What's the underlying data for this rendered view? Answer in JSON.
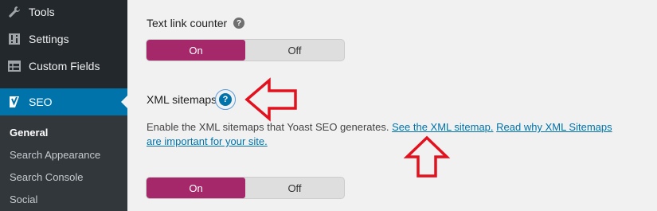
{
  "sidebar": {
    "items": [
      {
        "label": "Tools",
        "icon": "wrench-icon"
      },
      {
        "label": "Settings",
        "icon": "sliders-icon"
      },
      {
        "label": "Custom Fields",
        "icon": "table-icon"
      },
      {
        "label": "SEO",
        "icon": "yoast-icon",
        "active": true
      }
    ],
    "submenu": [
      {
        "label": "General",
        "current": true
      },
      {
        "label": "Search Appearance"
      },
      {
        "label": "Search Console"
      },
      {
        "label": "Social"
      }
    ]
  },
  "text_link_counter": {
    "label": "Text link counter",
    "help": "?",
    "toggle": {
      "on_label": "On",
      "off_label": "Off",
      "selected": "On"
    }
  },
  "xml_sitemaps": {
    "label": "XML sitemaps",
    "help": "?",
    "description": "Enable the XML sitemaps that Yoast SEO generates.",
    "link_see": "See the XML sitemap.",
    "link_read_line1": "Read why XML Sitemaps",
    "link_read_line2": "are important for your site.",
    "toggle": {
      "on_label": "On",
      "off_label": "Off",
      "selected": "On"
    }
  },
  "colors": {
    "sidebar_bg": "#23282d",
    "submenu_bg": "#32373c",
    "active_menu": "#0073aa",
    "toggle_on": "#a4286a",
    "link": "#0073aa",
    "annotation_arrow": "#e3101d"
  }
}
